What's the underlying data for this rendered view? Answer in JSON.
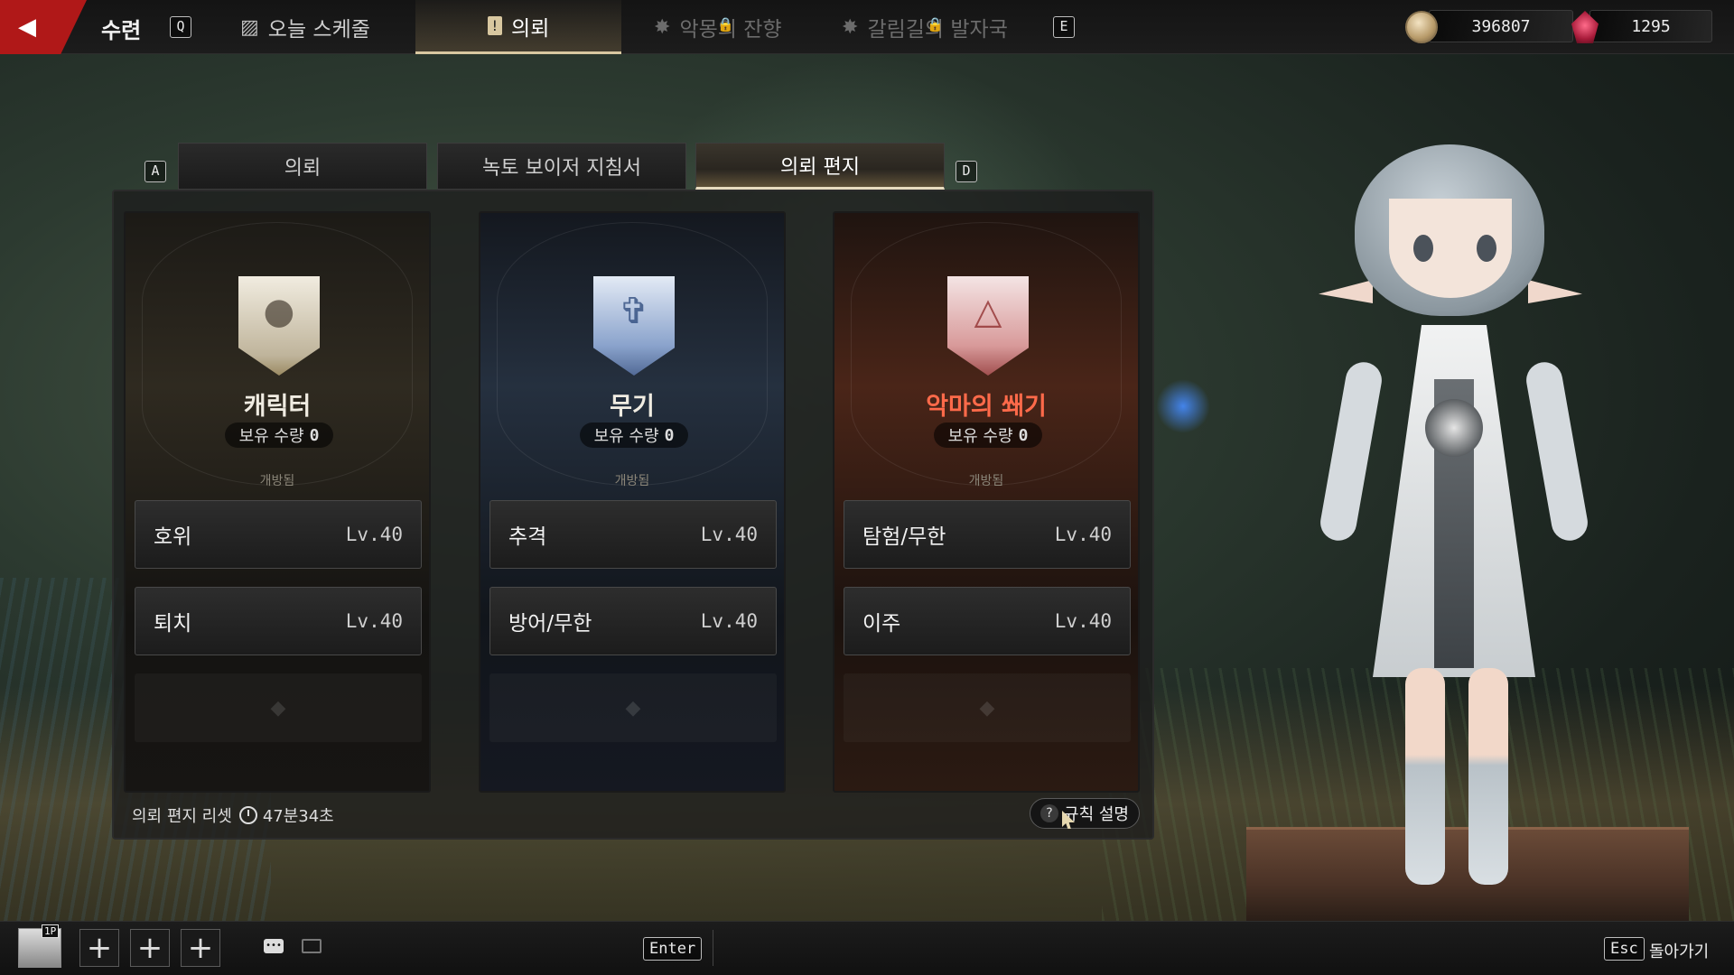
{
  "topbar": {
    "title": "수련",
    "key_q": "Q",
    "key_e": "E",
    "nav": {
      "schedule": "오늘 스케줄",
      "quest": "의뢰",
      "devil": "악몽의 잔향",
      "gallim": "갈림길의 발자국"
    },
    "currency_coin": "396807",
    "currency_gem": "1295"
  },
  "tabs": {
    "key_a": "A",
    "key_d": "D",
    "items": [
      "의뢰",
      "녹토 보이저 지침서",
      "의뢰 편지"
    ],
    "active": "의뢰 편지"
  },
  "cards": [
    {
      "name": "캐릭터",
      "owned_label": "보유 수량",
      "owned_count": "0",
      "status": "개방됨",
      "slots": [
        {
          "name": "호위",
          "level": "Lv.40"
        },
        {
          "name": "퇴치",
          "level": "Lv.40"
        }
      ]
    },
    {
      "name": "무기",
      "owned_label": "보유 수량",
      "owned_count": "0",
      "status": "개방됨",
      "slots": [
        {
          "name": "추격",
          "level": "Lv.40"
        },
        {
          "name": "방어/무한",
          "level": "Lv.40"
        }
      ]
    },
    {
      "name": "악마의 쐐기",
      "owned_label": "보유 수량",
      "owned_count": "0",
      "status": "개방됨",
      "slots": [
        {
          "name": "탐험/무한",
          "level": "Lv.40"
        },
        {
          "name": "이주",
          "level": "Lv.40"
        }
      ]
    }
  ],
  "footer": {
    "reset_label": "의뢰 편지 리셋",
    "reset_time": "47분34초",
    "rules_button": "규칙 설명"
  },
  "bottombar": {
    "player_badge": "1P",
    "enter_key": "Enter",
    "esc_key": "Esc",
    "back_label": "돌아가기"
  },
  "colors": {
    "accent_red": "#b01818",
    "devil_name": "#ff6a4a",
    "tab_active_border": "#e7dcc0"
  }
}
